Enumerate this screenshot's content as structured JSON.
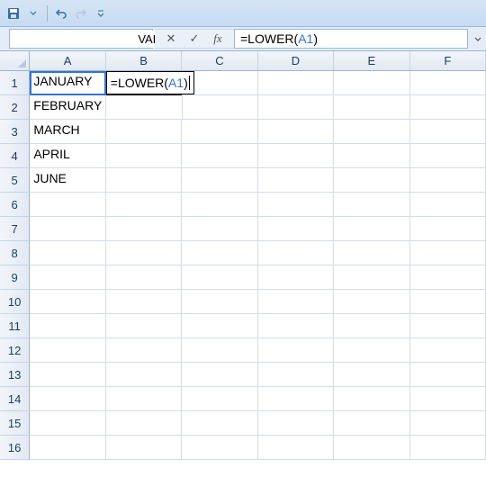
{
  "qat": {
    "save": "save-icon",
    "undo": "undo-icon",
    "redo": "redo-icon"
  },
  "formulaBar": {
    "nameBox": "VALUE",
    "cancel": "✕",
    "enter": "✓",
    "fx": "fx",
    "formulaPrefix": "=LOWER(",
    "formulaRef": "A1",
    "formulaSuffix": ")"
  },
  "columns": [
    "A",
    "B",
    "C",
    "D",
    "E",
    "F"
  ],
  "rows": [
    1,
    2,
    3,
    4,
    5,
    6,
    7,
    8,
    9,
    10,
    11,
    12,
    13,
    14,
    15,
    16
  ],
  "cells": {
    "A1": "JANUARY",
    "A2": "FEBRUARY",
    "A3": "MARCH",
    "A4": "APRIL",
    "A5": "JUNE"
  },
  "editing": {
    "cell": "B1",
    "prefix": "=LOWER(",
    "ref": "A1",
    "suffix": ")"
  },
  "refHighlight": "A1"
}
